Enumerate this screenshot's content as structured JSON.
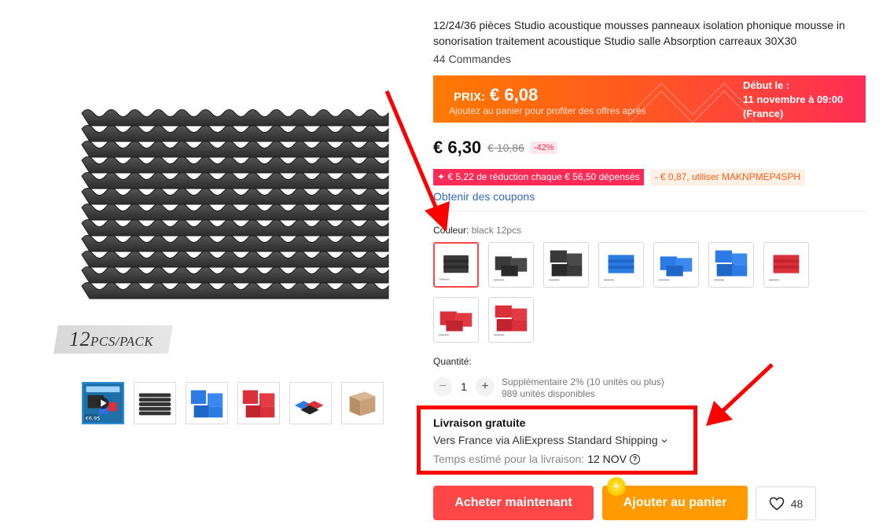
{
  "gallery": {
    "pack_label": {
      "count": "12",
      "unit": "PCS/PACK"
    },
    "thumbnails": [
      {
        "name": "video",
        "price_tag": "€6,95"
      },
      {
        "name": "black-stack"
      },
      {
        "name": "blue"
      },
      {
        "name": "red"
      },
      {
        "name": "colors"
      },
      {
        "name": "box"
      }
    ]
  },
  "product": {
    "title": "12/24/36 pièces Studio acoustique mousses panneaux isolation phonique mousse in sonorisation traitement acoustique Studio salle Absorption carreaux 30X30",
    "orders": "44 Commandes"
  },
  "promo": {
    "label": "PRIX:",
    "price": "€ 6,08",
    "subtitle": "Ajoutez au panier pour profiter des offres après",
    "start_label": "Début le :",
    "start_date": "11 novembre à 09:00",
    "start_region": "(France)"
  },
  "price": {
    "current": "€ 6,30",
    "original": "€ 10,86",
    "discount": "-42%"
  },
  "coupons": {
    "store_coupon": "✦ € 5,22 de réduction chaque € 56,50 dépensés",
    "code_coupon": "- € 0,87, utiliser MAKNPMEP4SPH",
    "link": "Obtenir des coupons"
  },
  "variant": {
    "label": "Couleur:",
    "value": "black 12pcs",
    "options": [
      {
        "color": "black",
        "count": 12
      },
      {
        "color": "black",
        "count": 24
      },
      {
        "color": "black",
        "count": 36
      },
      {
        "color": "blue",
        "count": 12
      },
      {
        "color": "blue",
        "count": 24
      },
      {
        "color": "blue",
        "count": 36
      },
      {
        "color": "red",
        "count": 12
      },
      {
        "color": "red",
        "count": 24
      },
      {
        "color": "red",
        "count": 36
      }
    ]
  },
  "quantity": {
    "label": "Quantité:",
    "minus": "−",
    "value": "1",
    "plus": "+",
    "bulk_info": "Supplémentaire 2% (10 unités ou plus)",
    "stock": "989 unités disponibles"
  },
  "shipping": {
    "title": "Livraison gratuite",
    "via": "Vers France via AliExpress Standard Shipping",
    "estimate_label": "Temps estimé pour la livraison:",
    "estimate_date": "12 NOV"
  },
  "actions": {
    "buy_now": "Acheter maintenant",
    "add_to_cart": "Ajouter au panier",
    "wishlist_count": "48"
  },
  "colors": {
    "accent_red": "#ff4747",
    "accent_orange": "#ff9a00",
    "link_blue": "#2f6ac1",
    "annotation_red": "#ff0000"
  }
}
